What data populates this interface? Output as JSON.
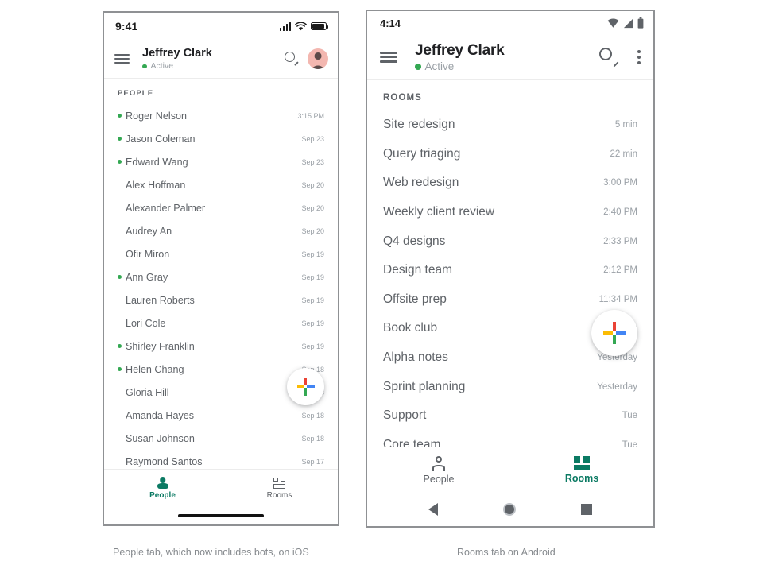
{
  "ios": {
    "status": {
      "time": "9:41",
      "signal_icon": "cellular-signal-icon",
      "wifi_icon": "wifi-icon",
      "battery_icon": "battery-icon"
    },
    "appbar": {
      "menu_icon": "hamburger-menu-icon",
      "title": "Jeffrey Clark",
      "presence": "Active",
      "presence_color": "#34a853",
      "search_icon": "search-icon",
      "avatar_icon": "avatar"
    },
    "section_label": "PEOPLE",
    "rows": [
      {
        "name": "Roger Nelson",
        "meta": "3:15 PM",
        "unread": true
      },
      {
        "name": "Jason Coleman",
        "meta": "Sep 23",
        "unread": true
      },
      {
        "name": "Edward Wang",
        "meta": "Sep 23",
        "unread": true
      },
      {
        "name": "Alex Hoffman",
        "meta": "Sep 20",
        "unread": false
      },
      {
        "name": "Alexander Palmer",
        "meta": "Sep 20",
        "unread": false
      },
      {
        "name": "Audrey An",
        "meta": "Sep 20",
        "unread": false
      },
      {
        "name": "Ofir Miron",
        "meta": "Sep 19",
        "unread": false
      },
      {
        "name": "Ann Gray",
        "meta": "Sep 19",
        "unread": true
      },
      {
        "name": "Lauren Roberts",
        "meta": "Sep 19",
        "unread": false
      },
      {
        "name": "Lori Cole",
        "meta": "Sep 19",
        "unread": false
      },
      {
        "name": "Shirley Franklin",
        "meta": "Sep 19",
        "unread": true
      },
      {
        "name": "Helen Chang",
        "meta": "Sep 18",
        "unread": true
      },
      {
        "name": "Gloria Hill",
        "meta": "Sep 18",
        "unread": false
      },
      {
        "name": "Amanda Hayes",
        "meta": "Sep 18",
        "unread": false
      },
      {
        "name": "Susan Johnson",
        "meta": "Sep 18",
        "unread": false
      },
      {
        "name": "Raymond Santos",
        "meta": "Sep 17",
        "unread": false
      }
    ],
    "fab": {
      "icon": "google-plus-add-icon"
    },
    "nav": [
      {
        "label": "People",
        "icon": "person-icon",
        "active": true
      },
      {
        "label": "Rooms",
        "icon": "rooms-grid-icon",
        "active": false
      }
    ],
    "home_indicator": "home-indicator",
    "caption": "People tab, which now includes bots, on iOS"
  },
  "android": {
    "status": {
      "time": "4:14",
      "wifi_icon": "wifi-icon",
      "signal_icon": "cellular-signal-icon",
      "battery_icon": "battery-icon"
    },
    "appbar": {
      "menu_icon": "hamburger-menu-icon",
      "title": "Jeffrey Clark",
      "presence": "Active",
      "presence_color": "#34a853",
      "search_icon": "search-icon",
      "overflow_icon": "kebab-overflow-icon"
    },
    "section_label": "ROOMS",
    "rows": [
      {
        "name": "Site redesign",
        "meta": "5 min"
      },
      {
        "name": "Query triaging",
        "meta": "22 min"
      },
      {
        "name": "Web redesign",
        "meta": "3:00 PM"
      },
      {
        "name": "Weekly client review",
        "meta": "2:40 PM"
      },
      {
        "name": "Q4 designs",
        "meta": "2:33 PM"
      },
      {
        "name": "Design team",
        "meta": "2:12 PM"
      },
      {
        "name": "Offsite prep",
        "meta": "11:34 PM"
      },
      {
        "name": "Book club",
        "meta": "Yesterday"
      },
      {
        "name": "Alpha notes",
        "meta": "Yesterday"
      },
      {
        "name": "Sprint planning",
        "meta": "Yesterday"
      },
      {
        "name": "Support",
        "meta": "Tue"
      },
      {
        "name": "Core team",
        "meta": "Tue"
      }
    ],
    "fab": {
      "icon": "google-plus-add-icon"
    },
    "nav": [
      {
        "label": "People",
        "icon": "person-icon",
        "active": false
      },
      {
        "label": "Rooms",
        "icon": "rooms-grid-icon",
        "active": true
      }
    ],
    "sysnav": {
      "back_icon": "android-back-icon",
      "home_icon": "android-home-icon",
      "recents_icon": "android-recents-icon"
    },
    "caption": "Rooms tab on Android"
  },
  "theme": {
    "accent_green": "#0b7a63",
    "presence_green": "#34a853",
    "text_primary": "#202124",
    "text_secondary": "#5f6368",
    "text_muted": "#9aa0a6",
    "divider": "#ececec",
    "frame_border": "#8f9194"
  }
}
